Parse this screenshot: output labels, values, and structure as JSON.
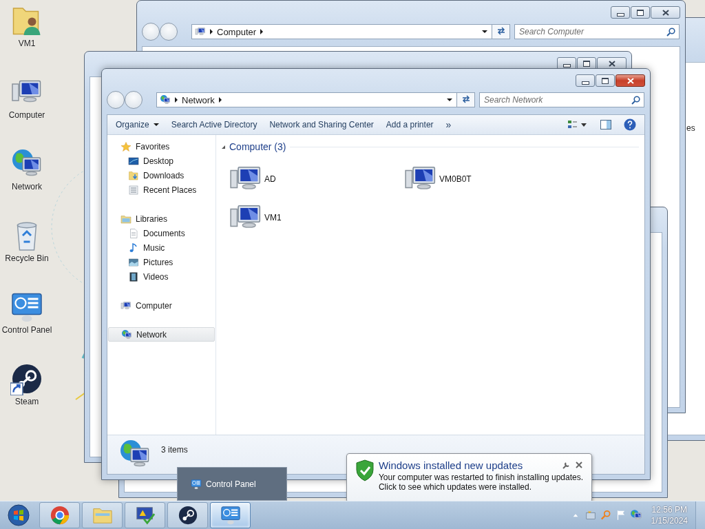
{
  "desktop_icons": [
    {
      "label": "VM1",
      "kind": "user-folder",
      "shortcut": false
    },
    {
      "label": "Computer",
      "kind": "computer",
      "shortcut": false
    },
    {
      "label": "Network",
      "kind": "network",
      "shortcut": false
    },
    {
      "label": "Recycle Bin",
      "kind": "recycle-bin",
      "shortcut": false
    },
    {
      "label": "Control Panel",
      "kind": "control-panel",
      "shortcut": false
    },
    {
      "label": "Steam",
      "kind": "steam",
      "shortcut": true
    }
  ],
  "back_window": {
    "address": "Computer",
    "search": {
      "placeholder": "Search Computer"
    }
  },
  "side_window": {
    "text": "es"
  },
  "window": {
    "address": "Network",
    "search": {
      "placeholder": "Search Network"
    },
    "toolbar": [
      {
        "label": "Organize",
        "dropdown": true
      },
      {
        "label": "Search Active Directory",
        "dropdown": false
      },
      {
        "label": "Network and Sharing Center",
        "dropdown": false
      },
      {
        "label": "Add a printer",
        "dropdown": false
      }
    ],
    "toolbar_more": "»",
    "nav": [
      {
        "label": "Favorites",
        "kind": "star",
        "selected": false,
        "children": [
          {
            "label": "Desktop",
            "kind": "desktop",
            "selected": false
          },
          {
            "label": "Downloads",
            "kind": "downloads",
            "selected": false
          },
          {
            "label": "Recent Places",
            "kind": "recent",
            "selected": false
          }
        ]
      },
      {
        "label": "Libraries",
        "kind": "libraries",
        "selected": false,
        "children": [
          {
            "label": "Documents",
            "kind": "documents",
            "selected": false
          },
          {
            "label": "Music",
            "kind": "music",
            "selected": false
          },
          {
            "label": "Pictures",
            "kind": "pictures",
            "selected": false
          },
          {
            "label": "Videos",
            "kind": "videos",
            "selected": false
          }
        ]
      },
      {
        "label": "Computer",
        "kind": "computer",
        "selected": false
      },
      {
        "label": "Network",
        "kind": "network",
        "selected": true
      }
    ],
    "group": {
      "title": "Computer (3)",
      "items": [
        {
          "name": "AD"
        },
        {
          "name": "VM0B0T"
        },
        {
          "name": "VM1"
        }
      ]
    },
    "status": "3 items"
  },
  "thumbnail": {
    "title": "Control Panel"
  },
  "notification": {
    "title": "Windows installed new updates",
    "lines": [
      "Your computer was restarted to finish installing updates.",
      "Click to see which updates were installed."
    ]
  },
  "taskbar": {
    "buttons": [
      {
        "kind": "chrome",
        "selected": false
      },
      {
        "kind": "explorer",
        "selected": false
      },
      {
        "kind": "security",
        "selected": false
      },
      {
        "kind": "steam",
        "selected": false
      },
      {
        "kind": "control-panel",
        "selected": true
      }
    ],
    "tray": [
      {
        "kind": "up"
      },
      {
        "kind": "update"
      },
      {
        "kind": "search"
      },
      {
        "kind": "flag"
      },
      {
        "kind": "network"
      }
    ],
    "time": "12:56 PM",
    "date": "1/15/2024"
  }
}
